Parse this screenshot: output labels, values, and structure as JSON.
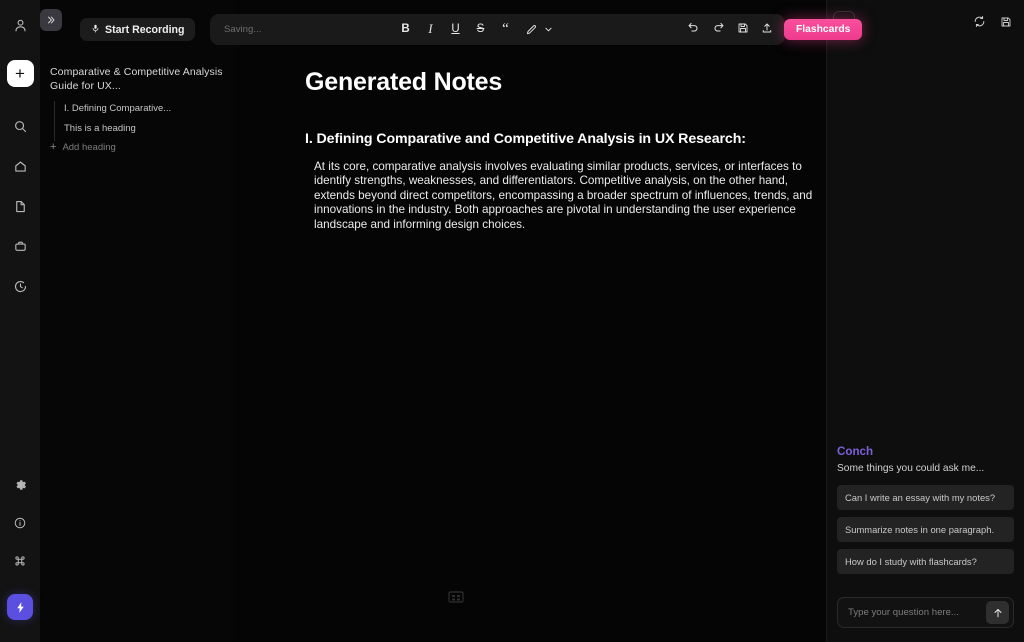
{
  "rail": {
    "account_icon": "user-icon",
    "add_label": "+",
    "items": [
      {
        "icon": "search-icon",
        "name": "search"
      },
      {
        "icon": "home-icon",
        "name": "home"
      },
      {
        "icon": "document-icon",
        "name": "documents"
      },
      {
        "icon": "folder-icon",
        "name": "folders"
      },
      {
        "icon": "history-icon",
        "name": "history"
      }
    ],
    "bottom_items": [
      {
        "icon": "gear-icon",
        "name": "settings"
      },
      {
        "icon": "info-icon",
        "name": "info"
      },
      {
        "icon": "command-icon",
        "name": "shortcuts"
      }
    ],
    "bolt_icon": "lightning-bolt-icon",
    "bolt_color": "#5b4fe0"
  },
  "outline": {
    "title": "Comparative & Competitive Analysis Guide for UX...",
    "items": [
      {
        "label": "I. Defining Comparative..."
      },
      {
        "label": "This is a heading"
      }
    ],
    "add_heading_label": "Add heading",
    "add_heading_icon": "plus-icon"
  },
  "topbar": {
    "collapse_icon": "chevrons-right-icon",
    "record_label": "Start Recording",
    "record_icon": "microphone-icon",
    "saving_text": "Saving...",
    "format_buttons": [
      {
        "label": "B",
        "name": "bold"
      },
      {
        "label": "I",
        "name": "italic"
      },
      {
        "label": "U",
        "name": "underline"
      },
      {
        "label": "S",
        "name": "strikethrough"
      },
      {
        "label": "“",
        "name": "blockquote"
      }
    ],
    "highlight_icon": "highlighter-pen-icon",
    "highlight_chevron": "chevron-down-icon",
    "actions": [
      {
        "icon": "undo-icon",
        "name": "undo"
      },
      {
        "icon": "redo-icon",
        "name": "redo"
      },
      {
        "icon": "save-icon",
        "name": "save"
      },
      {
        "icon": "export-icon",
        "name": "export"
      }
    ],
    "flashcards_label": "Flashcards",
    "flashcards_color": "#f03c8c"
  },
  "document": {
    "title": "Generated Notes",
    "heading": "I. Defining Comparative and Competitive Analysis in UX Research:",
    "paragraph": "At its core, comparative analysis involves evaluating similar products, services, or interfaces to identify strengths, weaknesses, and differentiators. Competitive analysis, on the other hand, extends beyond direct competitors, encompassing a broader spectrum of influences, trends, and innovations in the industry. Both approaches are pivotal in understanding the user experience landscape and informing design choices.",
    "drag_handle_icon": "grid-handle-icon"
  },
  "right_panel": {
    "toggle_icon": "chevrons-right-icon",
    "top_icons": [
      {
        "icon": "refresh-icon",
        "name": "refresh"
      },
      {
        "icon": "save-icon",
        "name": "save"
      }
    ],
    "assistant_name": "Conch",
    "assistant_color": "#7b61d9",
    "subtitle": "Some things you could ask me...",
    "suggestions": [
      "Can I write an essay with my notes?",
      "Summarize notes in one paragraph.",
      "How do I study with flashcards?"
    ],
    "input_placeholder": "Type your question here...",
    "send_icon": "arrow-up-icon"
  }
}
